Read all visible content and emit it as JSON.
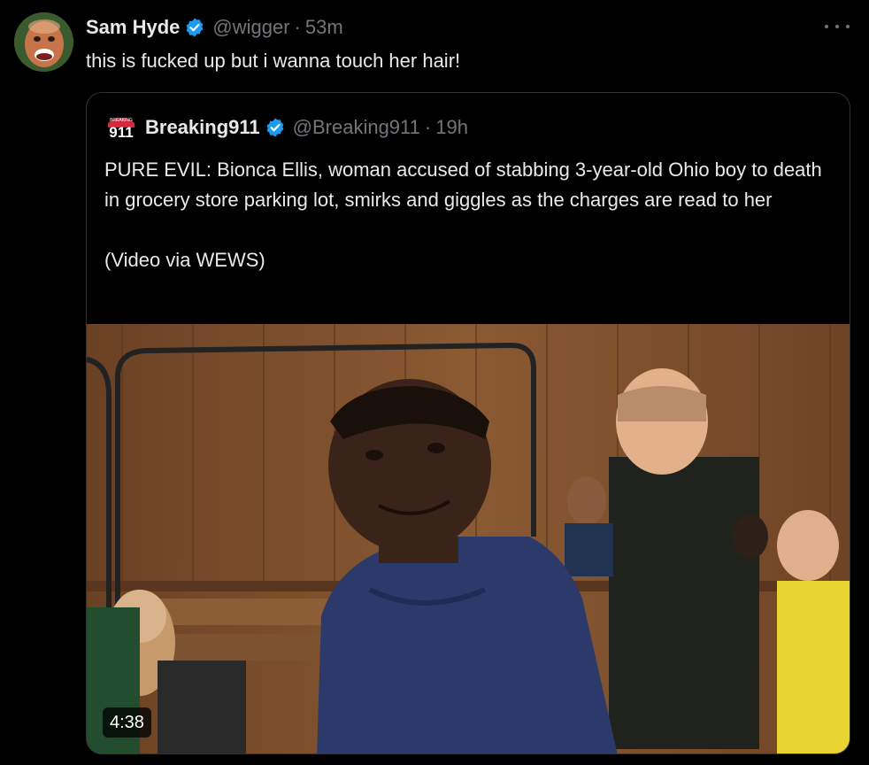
{
  "tweet": {
    "author": {
      "display_name": "Sam Hyde",
      "handle": "@wigger",
      "verified": true
    },
    "separator": "·",
    "time": "53m",
    "text": "this is fucked up but i wanna touch her hair!",
    "more_icon": "more-horizontal-icon"
  },
  "quoted_tweet": {
    "author": {
      "display_name": "Breaking911",
      "handle": "@Breaking911",
      "verified": true,
      "avatar_text": "911",
      "avatar_small_text": "BREAKING"
    },
    "separator": "·",
    "time": "19h",
    "text_lines": [
      "PURE EVIL: Bionca Ellis, woman accused of stabbing 3-year-old Ohio boy to death in grocery store parking lot, smirks and giggles as the charges are read to her",
      "(Video via WEWS)"
    ],
    "media": {
      "type": "video",
      "duration": "4:38"
    }
  },
  "colors": {
    "background": "#000000",
    "text_primary": "#e7e9ea",
    "text_secondary": "#71767b",
    "border": "#2f3336",
    "verified_blue": "#1d9bf0",
    "brand_red": "#d7263d"
  }
}
